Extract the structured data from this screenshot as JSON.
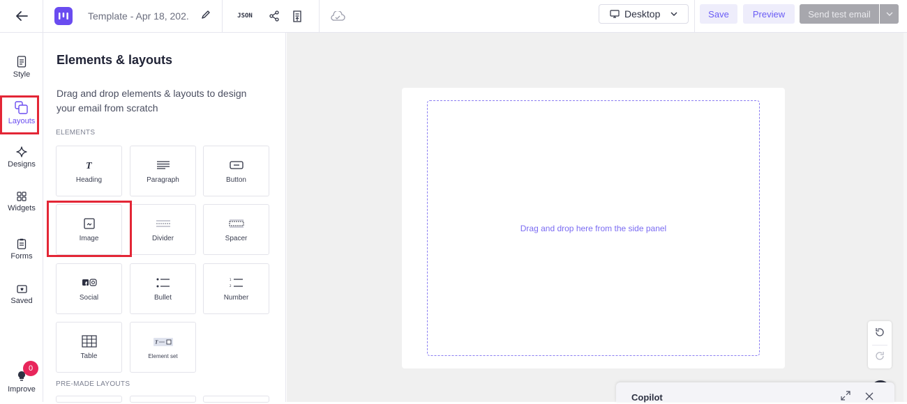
{
  "header": {
    "template_name": "Template - Apr 18, 202...",
    "json_label": "JSON",
    "device_label": "Desktop",
    "save_label": "Save",
    "preview_label": "Preview",
    "send_label": "Send test email"
  },
  "rail": {
    "items": [
      {
        "label": "Style",
        "icon": "style-icon"
      },
      {
        "label": "Layouts",
        "icon": "layouts-icon"
      },
      {
        "label": "Designs",
        "icon": "designs-icon"
      },
      {
        "label": "Widgets",
        "icon": "widgets-icon"
      },
      {
        "label": "Forms",
        "icon": "forms-icon"
      },
      {
        "label": "Saved",
        "icon": "saved-icon"
      }
    ],
    "improve_label": "Improve",
    "improve_badge": "0"
  },
  "panel": {
    "title": "Elements & layouts",
    "description": "Drag and drop elements & layouts to design your email from scratch",
    "elements_label": "ELEMENTS",
    "premade_label": "PRE-MADE LAYOUTS",
    "elements": [
      {
        "label": "Heading",
        "icon": "heading-icon"
      },
      {
        "label": "Paragraph",
        "icon": "paragraph-icon"
      },
      {
        "label": "Button",
        "icon": "button-icon"
      },
      {
        "label": "Image",
        "icon": "image-icon"
      },
      {
        "label": "Divider",
        "icon": "divider-icon"
      },
      {
        "label": "Spacer",
        "icon": "spacer-icon"
      },
      {
        "label": "Social",
        "icon": "social-icon"
      },
      {
        "label": "Bullet",
        "icon": "bullet-icon"
      },
      {
        "label": "Number",
        "icon": "number-icon"
      },
      {
        "label": "Table",
        "icon": "table-icon"
      },
      {
        "label": "Element set",
        "icon": "element-set-icon"
      }
    ]
  },
  "canvas": {
    "dropzone_text": "Drag and drop here from the side panel"
  },
  "copilot": {
    "label": "Copilot"
  },
  "colors": {
    "accent": "#6a4cf0",
    "highlight": "#e32636",
    "dropzone": "#8a7df2"
  }
}
